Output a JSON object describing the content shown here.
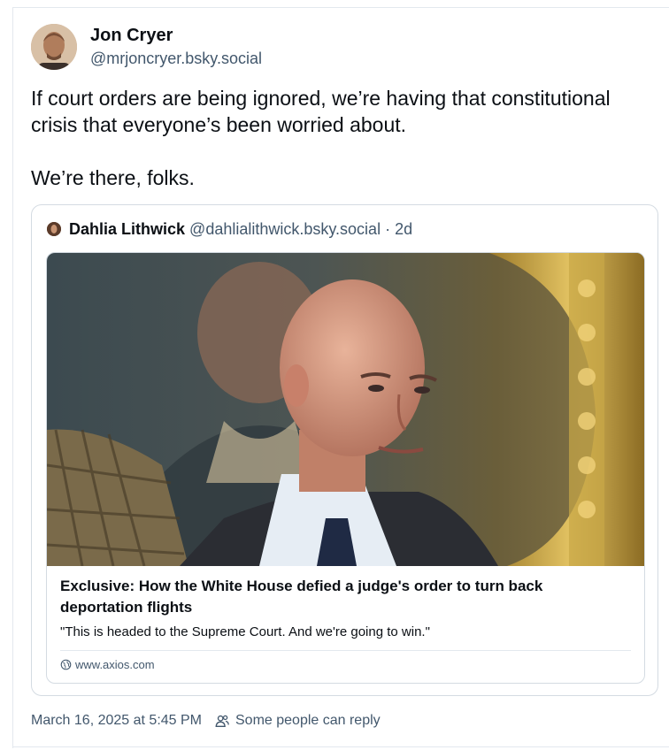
{
  "post": {
    "author": {
      "name": "Jon Cryer",
      "handle": "@mrjoncryer.bsky.social",
      "avatar_icon": "person-avatar"
    },
    "text": [
      "If court orders are being ignored, we’re having that constitutional crisis that everyone’s been worried about.",
      "We’re there, folks."
    ],
    "timestamp": "March 16, 2025 at 5:45 PM",
    "reply_setting": "Some people can reply",
    "reply_icon": "people-icon"
  },
  "quote": {
    "author": {
      "name": "Dahlia Lithwick",
      "handle": "@dahlialithwick.bsky.social",
      "avatar_icon": "person-avatar"
    },
    "separator": "·",
    "age": "2d",
    "link_card": {
      "title": "Exclusive: How the White House defied a judge's order to turn back deportation flights",
      "description": "\"This is headed to the Supreme Court. And we're going to win.\"",
      "domain": "www.axios.com",
      "domain_icon": "globe-icon"
    }
  },
  "colors": {
    "text": "#0b0f14",
    "muted": "#42576c",
    "border": "#d4dbe2"
  }
}
